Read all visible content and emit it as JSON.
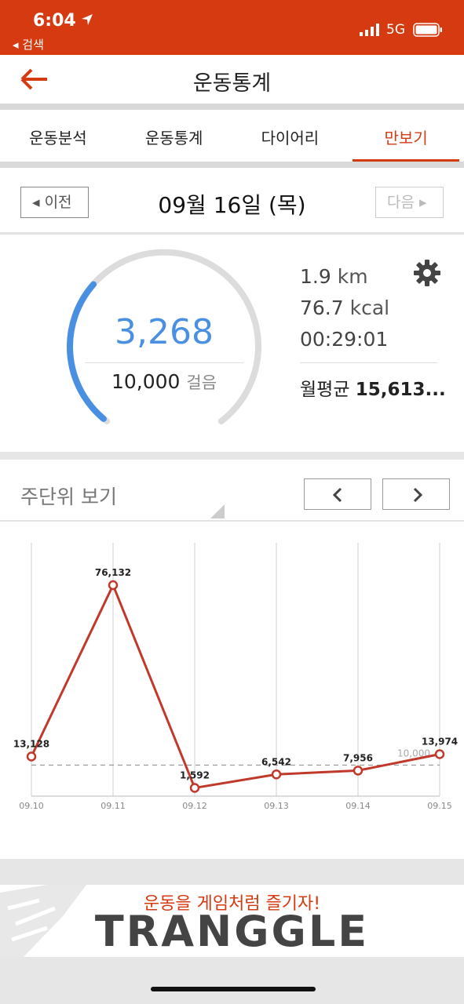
{
  "status": {
    "time": "6:04",
    "back_app": "◂ 검색",
    "network": "5G"
  },
  "header": {
    "title": "운동통계"
  },
  "tabs": [
    {
      "label": "운동분석"
    },
    {
      "label": "운동통계"
    },
    {
      "label": "다이어리"
    },
    {
      "label": "만보기"
    }
  ],
  "active_tab": "만보기",
  "date_nav": {
    "prev": "◂ 이전",
    "date": "09월 16일 (목)",
    "next": "다음 ▸"
  },
  "summary": {
    "steps": "3,268",
    "goal": "10,000",
    "goal_unit": "걸음",
    "progress": 0.3268,
    "distance_value": "1.9",
    "distance_unit": "km",
    "calories_value": "76.7",
    "calories_unit": "kcal",
    "duration": "00:29:01",
    "month_avg_label": "월평균",
    "month_avg_value": "15,613..."
  },
  "weekly": {
    "title": "주단위 보기"
  },
  "chart_data": {
    "type": "line",
    "x": [
      "09.10",
      "09.11",
      "09.12",
      "09.13",
      "09.14",
      "09.15"
    ],
    "values": [
      13128,
      76132,
      1592,
      6542,
      7956,
      13974
    ],
    "value_labels": [
      "13,128",
      "76,132",
      "1,592",
      "6,542",
      "7,956",
      "13,974"
    ],
    "goal_line": 10000,
    "goal_label": "10,000",
    "color": "#c0392b"
  },
  "ad": {
    "tagline": "운동을 게임처럼 즐기자!",
    "logo": "TRANGGLE"
  },
  "colors": {
    "accent": "#d53a10",
    "steps": "#4a90e2"
  }
}
